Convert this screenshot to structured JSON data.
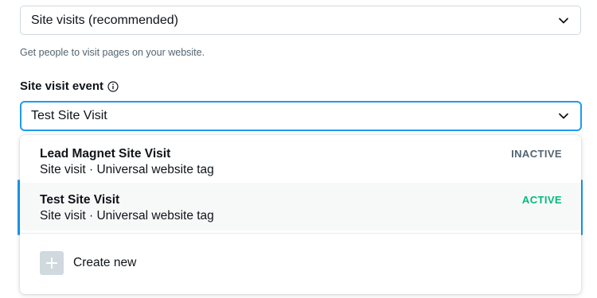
{
  "objective": {
    "selected": "Site visits (recommended)",
    "helper": "Get people to visit pages on your website."
  },
  "site_visit_event": {
    "label": "Site visit event",
    "selected": "Test Site Visit"
  },
  "dropdown": {
    "options": [
      {
        "title": "Lead Magnet Site Visit",
        "subtitle": "Site visit · Universal website tag",
        "status": "INACTIVE"
      },
      {
        "title": "Test Site Visit",
        "subtitle": "Site visit · Universal website tag",
        "status": "ACTIVE"
      }
    ],
    "create_new": "Create new"
  },
  "colors": {
    "accent": "#1d9bf0",
    "active_status": "#00ba7c",
    "inactive_status": "#536471",
    "plus_box": "#cfd9de"
  },
  "icons": {
    "chevron": "chevron-down-icon",
    "info": "info-icon",
    "plus": "plus-icon"
  }
}
